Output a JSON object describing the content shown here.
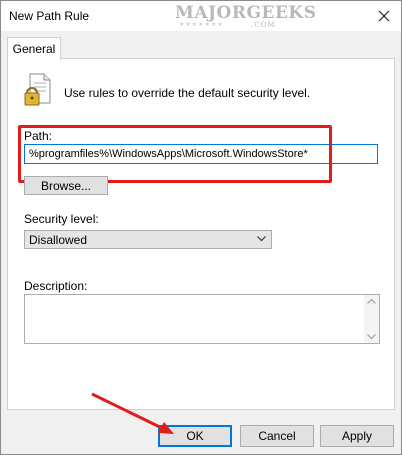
{
  "window": {
    "title": "New Path Rule"
  },
  "watermark": {
    "brand": "MAJORGEEKS",
    "sub": ".COM",
    "stars": "★★★★★★★"
  },
  "tabs": [
    {
      "label": "General"
    }
  ],
  "intro_text": "Use rules to override the default security level.",
  "path": {
    "label": "Path:",
    "value": "%programfiles%\\WindowsApps\\Microsoft.WindowsStore*"
  },
  "browse": {
    "label": "Browse..."
  },
  "security_level": {
    "label": "Security level:",
    "value": "Disallowed"
  },
  "description": {
    "label": "Description:",
    "value": ""
  },
  "buttons": {
    "ok": "OK",
    "cancel": "Cancel",
    "apply": "Apply"
  },
  "colors": {
    "accent": "#0078d7",
    "annotation_red": "#e21b1b"
  },
  "icons": [
    "close-icon",
    "lock-document-icon",
    "chevron-down-icon",
    "scroll-up-icon",
    "scroll-down-icon"
  ]
}
